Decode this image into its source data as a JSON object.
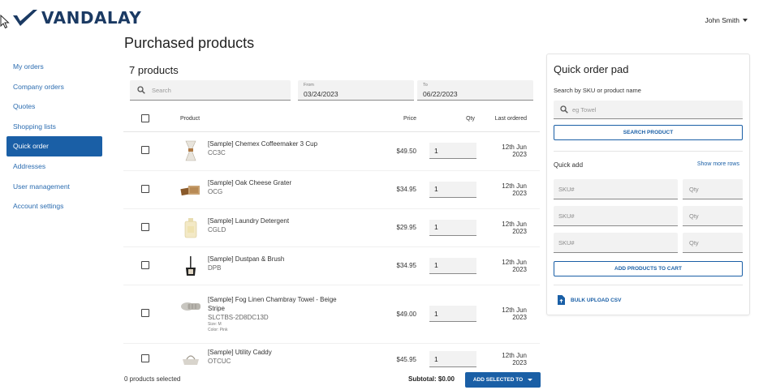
{
  "brand": {
    "name": "VANDALAY",
    "color": "#1b3a63",
    "accent": "#1a5fa6"
  },
  "header": {
    "user_name": "John Smith"
  },
  "page": {
    "title": "Purchased products"
  },
  "sidebar": {
    "items": [
      {
        "label": "My orders",
        "active": false
      },
      {
        "label": "Company orders",
        "active": false
      },
      {
        "label": "Quotes",
        "active": false
      },
      {
        "label": "Shopping lists",
        "active": false
      },
      {
        "label": "Quick order",
        "active": true
      },
      {
        "label": "Addresses",
        "active": false
      },
      {
        "label": "User management",
        "active": false
      },
      {
        "label": "Account settings",
        "active": false
      }
    ]
  },
  "products": {
    "count_label": "7 products",
    "search_placeholder": "Search",
    "date_from": {
      "label": "From",
      "value": "03/24/2023"
    },
    "date_to": {
      "label": "To",
      "value": "06/22/2023"
    },
    "columns": {
      "product": "Product",
      "price": "Price",
      "qty": "Qty",
      "last_ordered": "Last ordered"
    },
    "rows": [
      {
        "name": "[Sample] Chemex Coffeemaker 3 Cup",
        "sku": "CC3C",
        "price": "$49.50",
        "qty": "1",
        "last_ordered": "12th Jun 2023",
        "icon": "coffeemaker-icon"
      },
      {
        "name": "[Sample] Oak Cheese Grater",
        "sku": "OCG",
        "price": "$34.95",
        "qty": "1",
        "last_ordered": "12th Jun 2023",
        "icon": "grater-icon"
      },
      {
        "name": "[Sample] Laundry Detergent",
        "sku": "CGLD",
        "price": "$29.95",
        "qty": "1",
        "last_ordered": "12th Jun 2023",
        "icon": "detergent-icon"
      },
      {
        "name": "[Sample] Dustpan & Brush",
        "sku": "DPB",
        "price": "$34.95",
        "qty": "1",
        "last_ordered": "12th Jun 2023",
        "icon": "dustpan-icon"
      },
      {
        "name": "[Sample] Fog Linen Chambray Towel - Beige Stripe",
        "sku": "SLCTBS-2D8DC13D",
        "size": "Size: M",
        "color": "Color: Pink",
        "price": "$49.00",
        "qty": "1",
        "last_ordered": "12th Jun 2023",
        "icon": "towel-icon"
      },
      {
        "name": "[Sample] Utility Caddy",
        "sku": "OTCUC",
        "price": "$45.95",
        "qty": "1",
        "last_ordered": "12th Jun 2023",
        "icon": "caddy-icon"
      }
    ]
  },
  "footer": {
    "selected_label": "0 products selected",
    "subtotal_label": "Subtotal: $0.00",
    "add_selected_label": "ADD SELECTED TO"
  },
  "quick_order_pad": {
    "title": "Quick order pad",
    "search_label": "Search by SKU or product name",
    "search_placeholder": "eg Towel",
    "search_button": "SEARCH PRODUCT",
    "quick_add_label": "Quick add",
    "show_more": "Show more rows",
    "sku_placeholder": "SKU#",
    "qty_placeholder": "Qty",
    "add_to_cart": "ADD PRODUCTS TO CART",
    "bulk_upload": "BULK UPLOAD CSV"
  }
}
